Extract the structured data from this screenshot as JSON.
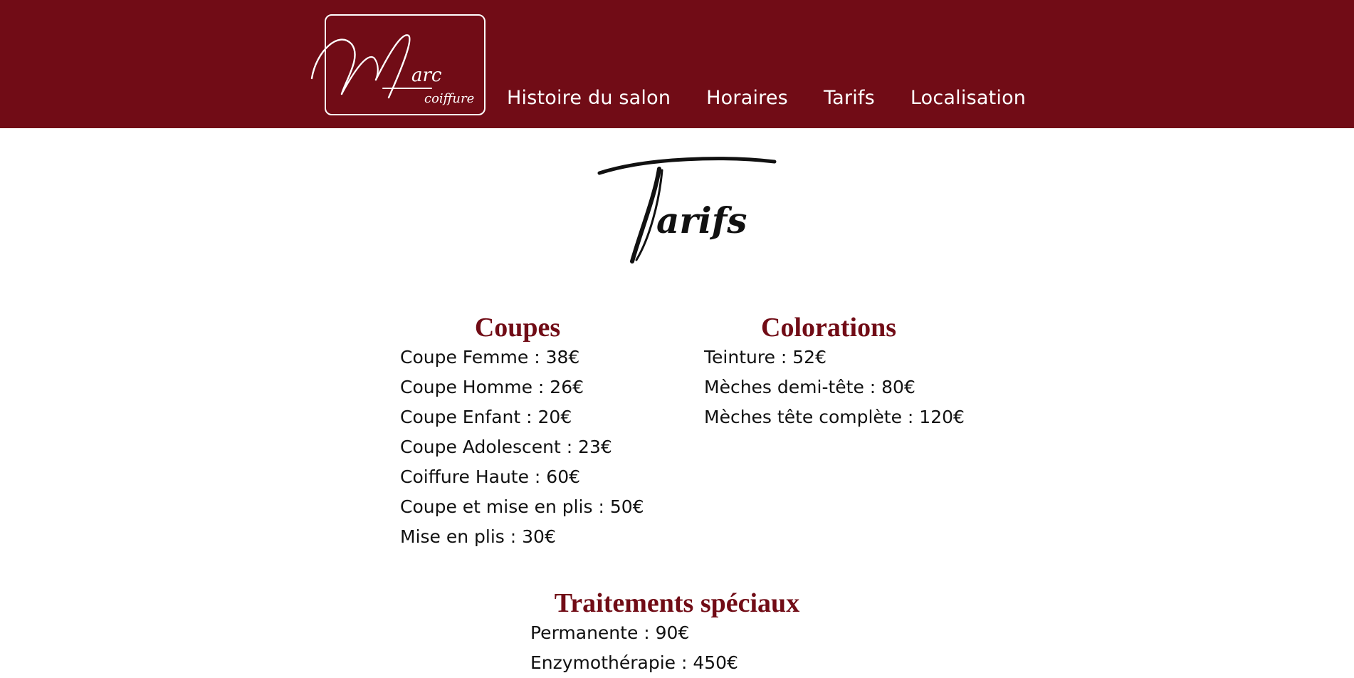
{
  "header": {
    "logo": {
      "text_main": "Marc",
      "text_sub": "coiffure"
    },
    "nav": [
      {
        "label": "Histoire du salon"
      },
      {
        "label": "Horaires"
      },
      {
        "label": "Tarifs"
      },
      {
        "label": "Localisation"
      }
    ]
  },
  "page": {
    "title": "Tarifs"
  },
  "sections": {
    "coupes": {
      "title": "Coupes",
      "items": [
        "Coupe Femme : 38€",
        "Coupe Homme : 26€",
        "Coupe Enfant : 20€",
        "Coupe Adolescent : 23€",
        "Coiffure Haute : 60€",
        "Coupe et mise en plis : 50€",
        "Mise en plis : 30€"
      ]
    },
    "colorations": {
      "title": "Colorations",
      "items": [
        "Teinture : 52€",
        "Mèches demi-tête : 80€",
        "Mèches tête complète : 120€"
      ]
    },
    "traitements": {
      "title": "Traitements spéciaux",
      "items": [
        "Permanente : 90€",
        "Enzymothérapie : 450€"
      ]
    }
  },
  "colors": {
    "brand": "#710c16",
    "text": "#111111",
    "background": "#ffffff"
  }
}
